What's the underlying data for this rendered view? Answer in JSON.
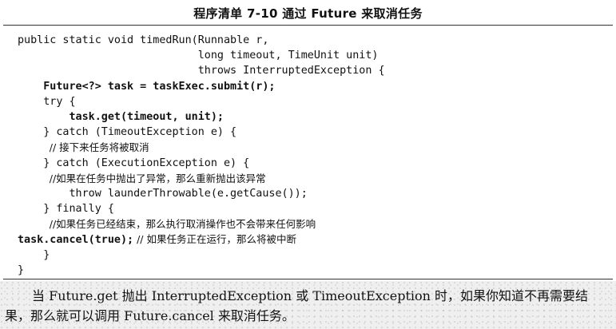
{
  "listing": {
    "title": "程序清单 7-10    通过 Future 来取消任务"
  },
  "code": {
    "lines": [
      "public static void timedRun(Runnable r,",
      "                            long timeout, TimeUnit unit)",
      "                            throws InterruptedException {",
      "    Future<?> task = taskExec.submit(r);",
      "    try {",
      "        task.get(timeout, unit);",
      "    } catch (TimeoutException e) {",
      "          // 接下来任务将被取消",
      "    } catch (ExecutionException e) {",
      "          //如果在任务中抛出了异常，那么重新抛出该异常",
      "        throw launderThrowable(e.getCause());",
      "    } finally {",
      "          //如果任务已经结束，那么执行取消操作也不会带来任何影响",
      "task.cancel(true);",
      " // 如果任务正在运行，那么将被中断",
      "    }",
      "}"
    ]
  },
  "caption": {
    "text": "当 Future.get 抛出 InterruptedException 或 TimeoutException 时，如果你知道不再需要结果，那么就可以调用 Future.cancel 来取消任务。"
  }
}
